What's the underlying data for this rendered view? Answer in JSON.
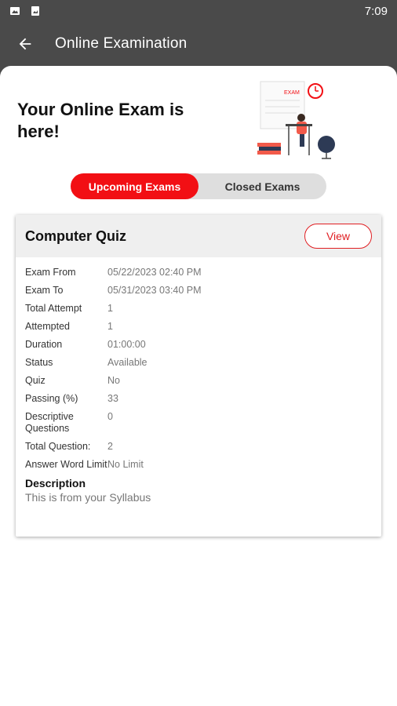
{
  "status_bar": {
    "time": "7:09"
  },
  "app_bar": {
    "title": "Online Examination"
  },
  "hero": {
    "title": "Your Online Exam is here!",
    "illustration_text": "EXAM"
  },
  "tabs": [
    {
      "label": "Upcoming Exams",
      "active": true
    },
    {
      "label": "Closed Exams",
      "active": false
    }
  ],
  "exam": {
    "title": "Computer Quiz",
    "view_label": "View",
    "rows": [
      {
        "label": "Exam From",
        "value": "05/22/2023 02:40 PM"
      },
      {
        "label": "Exam To",
        "value": "05/31/2023 03:40 PM"
      },
      {
        "label": "Total Attempt",
        "value": "1"
      },
      {
        "label": "Attempted",
        "value": "1"
      },
      {
        "label": "Duration",
        "value": "01:00:00"
      },
      {
        "label": "Status",
        "value": "Available"
      },
      {
        "label": "Quiz",
        "value": "No"
      },
      {
        "label": "Passing (%)",
        "value": "33"
      },
      {
        "label": "Descriptive Questions",
        "value": "0"
      },
      {
        "label": "Total Question:",
        "value": "2"
      },
      {
        "label": "Answer Word Limit",
        "value": "No Limit"
      }
    ],
    "description_label": "Description",
    "description_text": "This is from your Syllabus"
  },
  "colors": {
    "accent": "#f20f14",
    "bar": "#4a4a4a"
  }
}
